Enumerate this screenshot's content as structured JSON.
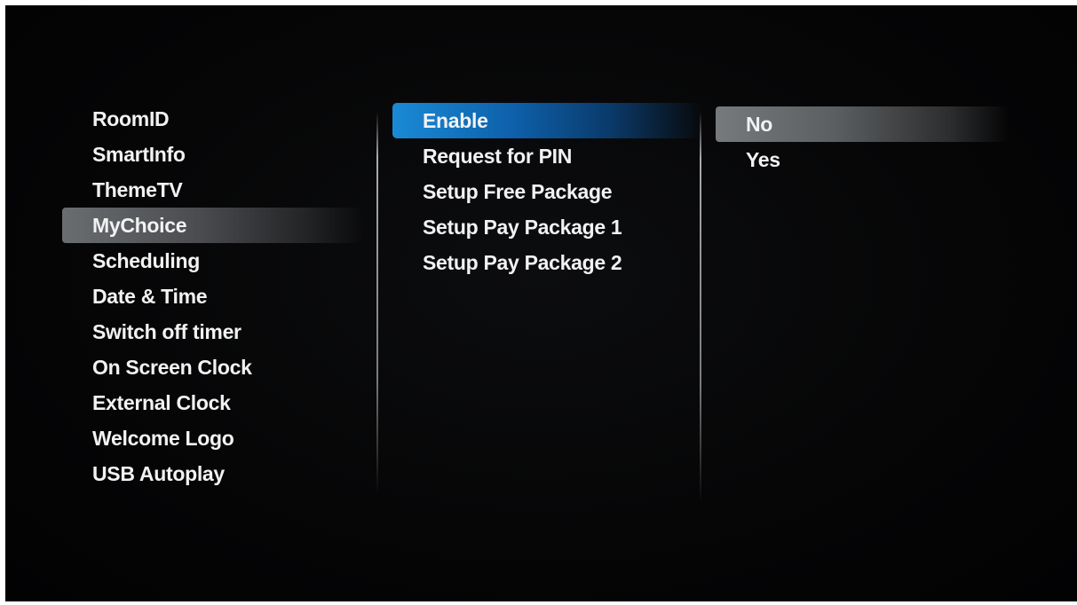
{
  "menu": {
    "left": {
      "selected_index": 3,
      "items": [
        "RoomID",
        "SmartInfo",
        "ThemeTV",
        "MyChoice",
        "Scheduling",
        "Date & Time",
        "Switch off timer",
        "On Screen Clock",
        "External Clock",
        "Welcome Logo",
        "USB Autoplay"
      ]
    },
    "middle": {
      "focused_index": 0,
      "items": [
        "Enable",
        "Request for PIN",
        "Setup Free Package",
        "Setup Pay Package 1",
        "Setup Pay Package 2"
      ]
    },
    "right": {
      "selected_index": 0,
      "items": [
        "No",
        "Yes"
      ]
    }
  },
  "colors": {
    "focus_highlight": "#1a8ad6",
    "selected_highlight": "#6a6d70",
    "text": "#f2f2f2",
    "background": "#060607"
  }
}
